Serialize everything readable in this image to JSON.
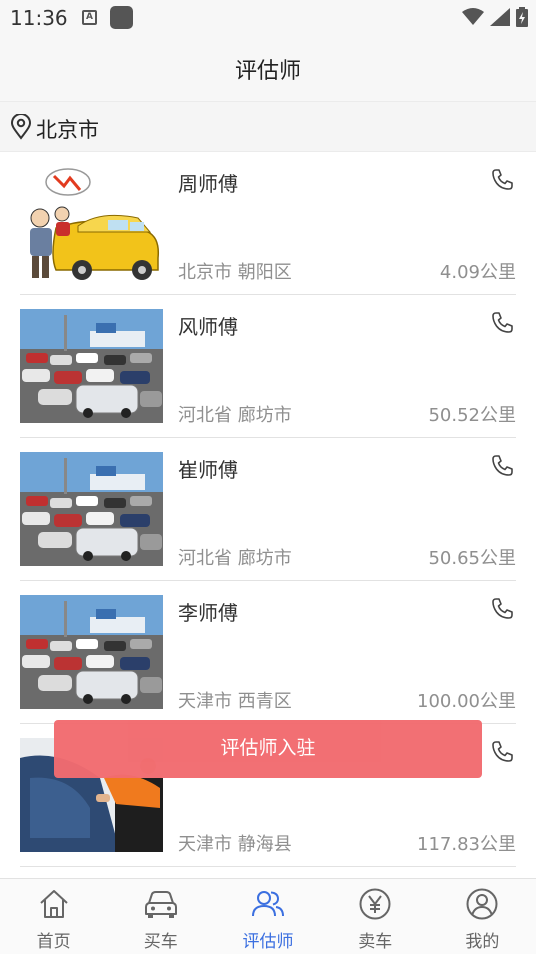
{
  "status_bar": {
    "time": "11:36",
    "a_icon": "A"
  },
  "header": {
    "title": "评估师"
  },
  "location": {
    "city": "北京市",
    "icon": "location-pin-icon"
  },
  "list": [
    {
      "name": "周师傅",
      "area": "北京市 朝阳区",
      "distance": "4.09公里",
      "image": "cartoon-car-photo"
    },
    {
      "name": "风师傅",
      "area": "河北省 廊坊市",
      "distance": "50.52公里",
      "image": "car-lot-photo"
    },
    {
      "name": "崔师傅",
      "area": "河北省 廊坊市",
      "distance": "50.65公里",
      "image": "car-lot-photo"
    },
    {
      "name": "李师傅",
      "area": "天津市 西青区",
      "distance": "100.00公里",
      "image": "car-lot-photo"
    },
    {
      "name": "",
      "area": "天津市 静海县",
      "distance": "117.83公里",
      "image": "car-inspection-photo"
    }
  ],
  "join_button": {
    "label": "评估师入驻"
  },
  "tabs": [
    {
      "label": "首页",
      "icon": "home-icon",
      "active": false
    },
    {
      "label": "买车",
      "icon": "car-icon",
      "active": false
    },
    {
      "label": "评估师",
      "icon": "users-icon",
      "active": true
    },
    {
      "label": "卖车",
      "icon": "yen-icon",
      "active": false
    },
    {
      "label": "我的",
      "icon": "profile-icon",
      "active": false
    }
  ],
  "colors": {
    "accent": "#3b6fe0",
    "join_button": "#f26b6f",
    "muted_text": "#8f8f8f"
  }
}
